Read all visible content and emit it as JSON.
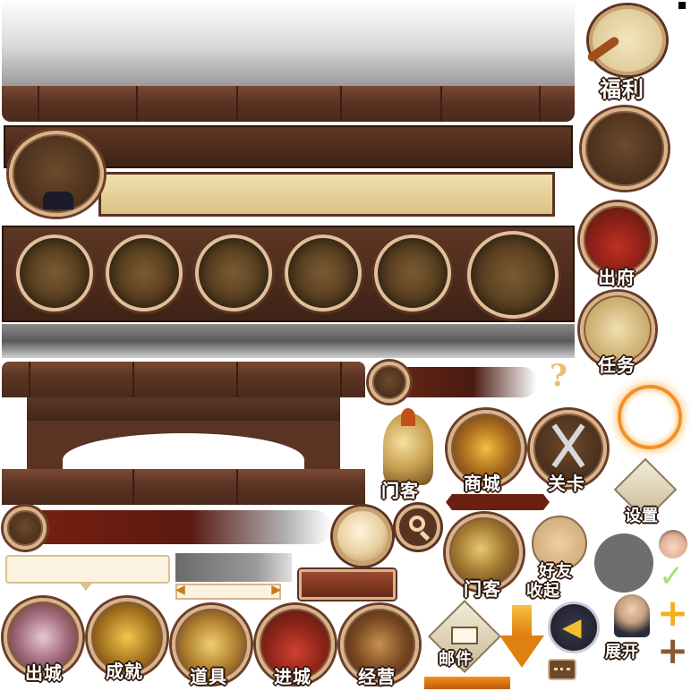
{
  "labels": {
    "fuli": "福利",
    "chufu": "出府",
    "renwu": "任务",
    "menke1": "门客",
    "shangcheng": "商城",
    "guanka": "关卡",
    "shezhi": "设置",
    "menke2": "门客",
    "haoyou": "好友",
    "shouqi": "收起",
    "chucheng": "出城",
    "chengjiu": "成就",
    "daoju": "道具",
    "jincheng": "进城",
    "jingying": "经营",
    "youjian": "邮件",
    "zhankai": "展开"
  },
  "glyphs": {
    "question": "?",
    "check": "✓",
    "plus": "+",
    "arrow_left": "◀",
    "arrow_right": "▶"
  },
  "colors": {
    "wood": "#5a3323",
    "gold": "#d8b48a",
    "parchment": "#e8d4a0",
    "orange": "#e07a10"
  }
}
